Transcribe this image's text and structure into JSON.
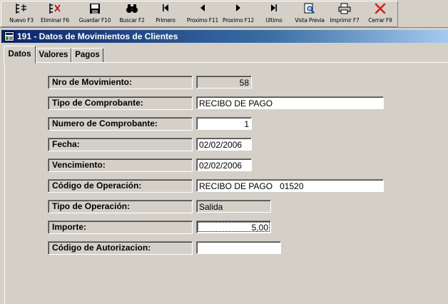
{
  "toolbar": {
    "buttons": [
      {
        "id": "nuevo",
        "label": "Nuevo F3",
        "icon": "new-record-icon"
      },
      {
        "id": "eliminar",
        "label": "Eliminar F6",
        "icon": "delete-record-icon"
      },
      {
        "id": "guardar",
        "label": "Guardar F10",
        "icon": "save-disk-icon"
      },
      {
        "id": "buscar",
        "label": "Buscar F2",
        "icon": "binoculars-icon"
      },
      {
        "id": "primero",
        "label": "Primero",
        "icon": "first-record-icon"
      },
      {
        "id": "anterior",
        "label": "Proximo F11",
        "icon": "previous-record-icon"
      },
      {
        "id": "siguiente",
        "label": "Proximo F12",
        "icon": "next-record-icon"
      },
      {
        "id": "ultimo",
        "label": "Ultimo",
        "icon": "last-record-icon"
      },
      {
        "id": "vista",
        "label": "Vista Previa",
        "icon": "print-preview-icon"
      },
      {
        "id": "imprimir",
        "label": "Imprimir F7",
        "icon": "printer-icon"
      },
      {
        "id": "cerrar",
        "label": "Cerrar F9",
        "icon": "close-x-icon"
      }
    ]
  },
  "window": {
    "title": "191 - Datos de Movimientos de Clientes"
  },
  "tabs": [
    {
      "label": "Datos",
      "active": true
    },
    {
      "label": "Valores",
      "active": false
    },
    {
      "label": "Pagos",
      "active": false
    }
  ],
  "form": {
    "nro_movimiento": {
      "label": "Nro de Movimiento:",
      "value": "58"
    },
    "tipo_comprobante": {
      "label": "Tipo de Comprobante:",
      "value": "RECIBO DE PAGO"
    },
    "numero_comprobante": {
      "label": "Numero de Comprobante:",
      "value": "1"
    },
    "fecha": {
      "label": "Fecha:",
      "value": "02/02/2006"
    },
    "vencimiento": {
      "label": "Vencimiento:",
      "value": "02/02/2006"
    },
    "codigo_operacion": {
      "label": "Código de Operación:",
      "value": "RECIBO DE PAGO   01520"
    },
    "tipo_operacion": {
      "label": "Tipo de Operación:",
      "value": "Salida"
    },
    "importe": {
      "label": "Importe:",
      "value": "5,00"
    },
    "codigo_autorizacion": {
      "label": "Código de Autorizacion:",
      "value": ""
    }
  },
  "colors": {
    "title_start": "#0a246a",
    "title_end": "#a6caf0",
    "face": "#d4d0c8",
    "close_red": "#d42020"
  }
}
